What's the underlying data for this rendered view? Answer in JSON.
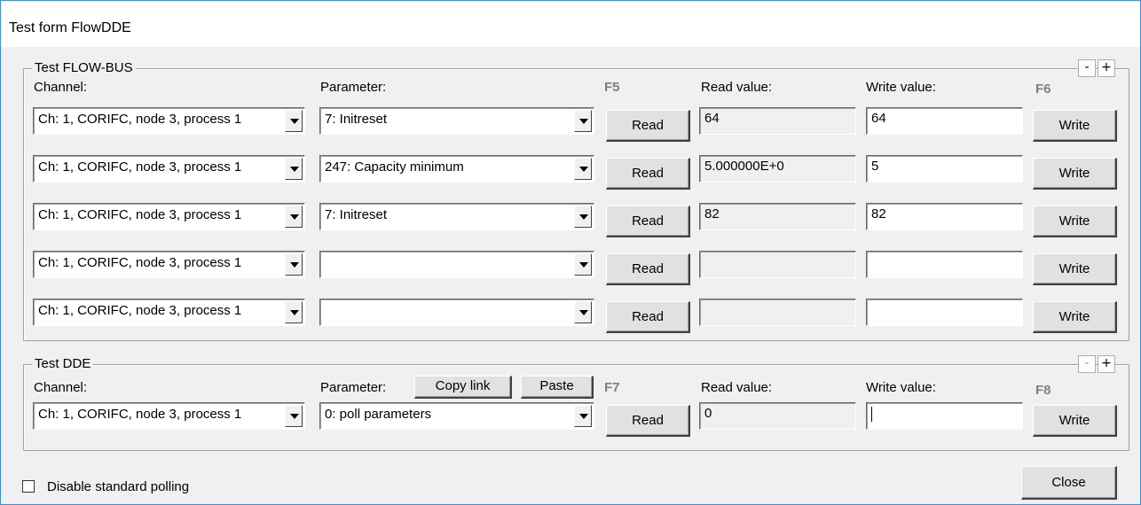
{
  "window": {
    "title": "Test form FlowDDE"
  },
  "flowbus": {
    "group_label": "Test FLOW-BUS",
    "minus": "-",
    "plus": "+",
    "channel_label": "Channel:",
    "parameter_label": "Parameter:",
    "read_fkey": "F5",
    "read_value_label": "Read value:",
    "write_value_label": "Write value:",
    "write_fkey": "F6",
    "rows": [
      {
        "channel": "Ch: 1, CORIFC, node 3, process 1",
        "parameter": "7: Initreset",
        "read_btn": "Read",
        "read_value": "64",
        "write_value": "64",
        "write_btn": "Write"
      },
      {
        "channel": "Ch: 1, CORIFC, node 3, process 1",
        "parameter": "247: Capacity minimum",
        "read_btn": "Read",
        "read_value": "5.000000E+0",
        "write_value": "5",
        "write_btn": "Write"
      },
      {
        "channel": "Ch: 1, CORIFC, node 3, process 1",
        "parameter": "7: Initreset",
        "read_btn": "Read",
        "read_value": "82",
        "write_value": "82",
        "write_btn": "Write"
      },
      {
        "channel": "Ch: 1, CORIFC, node 3, process 1",
        "parameter": "",
        "read_btn": "Read",
        "read_value": "",
        "write_value": "",
        "write_btn": "Write"
      },
      {
        "channel": "Ch: 1, CORIFC, node 3, process 1",
        "parameter": "",
        "read_btn": "Read",
        "read_value": "",
        "write_value": "",
        "write_btn": "Write"
      }
    ]
  },
  "dde": {
    "group_label": "Test DDE",
    "minus": "-",
    "plus": "+",
    "channel_label": "Channel:",
    "parameter_label": "Parameter:",
    "copy_link": "Copy link",
    "paste": "Paste",
    "read_fkey": "F7",
    "read_value_label": "Read value:",
    "write_value_label": "Write value:",
    "write_fkey": "F8",
    "channel": "Ch: 1, CORIFC, node 3, process 1",
    "parameter": "0: poll parameters",
    "read_btn": "Read",
    "read_value": "0",
    "write_value": "",
    "write_btn": "Write"
  },
  "footer": {
    "disable_polling_label": "Disable standard polling",
    "disable_polling_checked": false,
    "close": "Close"
  }
}
